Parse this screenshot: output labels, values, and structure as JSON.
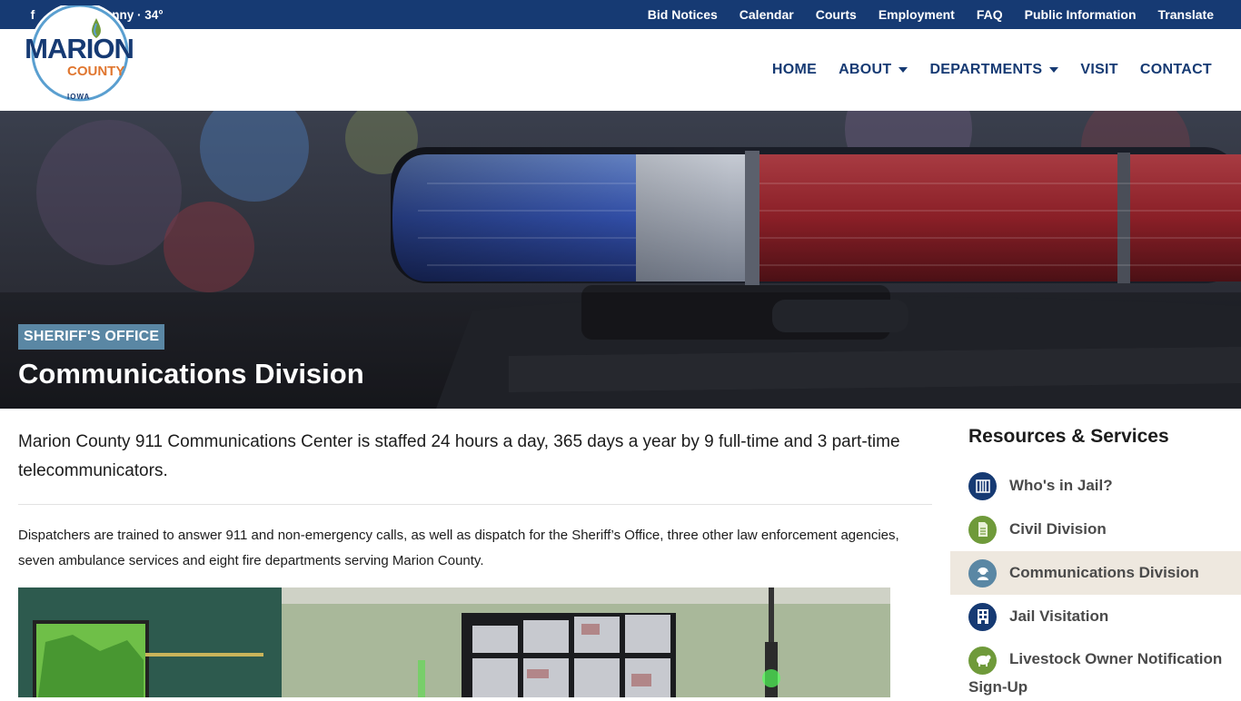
{
  "topbar": {
    "weather": "Sunny · 34°",
    "links": [
      "Bid Notices",
      "Calendar",
      "Courts",
      "Employment",
      "FAQ",
      "Public Information",
      "Translate"
    ]
  },
  "logo": {
    "line1": "MARION",
    "line2": "COUNTY",
    "line3": "IOWA"
  },
  "nav": {
    "home": "HOME",
    "about": "ABOUT",
    "departments": "DEPARTMENTS",
    "visit": "VISIT",
    "contact": "CONTACT"
  },
  "hero": {
    "tag": "SHERIFF'S OFFICE",
    "title": "Communications Division"
  },
  "main": {
    "lead": "Marion County 911 Communications Center is staffed 24 hours a day, 365 days a year by 9 full-time and 3 part-time telecommunicators.",
    "body": "Dispatchers are trained to answer 911 and non-emergency calls, as well as dispatch for the Sheriff’s Office, three other law enforcement agencies, seven ambulance services and eight fire departments serving Marion County."
  },
  "sidebar": {
    "heading": "Resources & Services",
    "items": [
      {
        "label": "Who's in Jail?",
        "icon": "jail-building-icon",
        "color": "#163a73"
      },
      {
        "label": "Civil Division",
        "icon": "document-icon",
        "color": "#6f9a3a"
      },
      {
        "label": "Communications Division",
        "icon": "headset-operator-icon",
        "color": "#5a87a4"
      },
      {
        "label": "Jail Visitation",
        "icon": "building-icon",
        "color": "#163a73"
      },
      {
        "label": "Livestock Owner Notification Sign-Up",
        "icon": "livestock-icon",
        "color": "#6f9a3a"
      }
    ]
  },
  "colors": {
    "navy": "#163a73",
    "tag": "#5a87a4",
    "green": "#6f9a3a",
    "orange": "#e0762f",
    "active_bg": "#eee8df"
  }
}
